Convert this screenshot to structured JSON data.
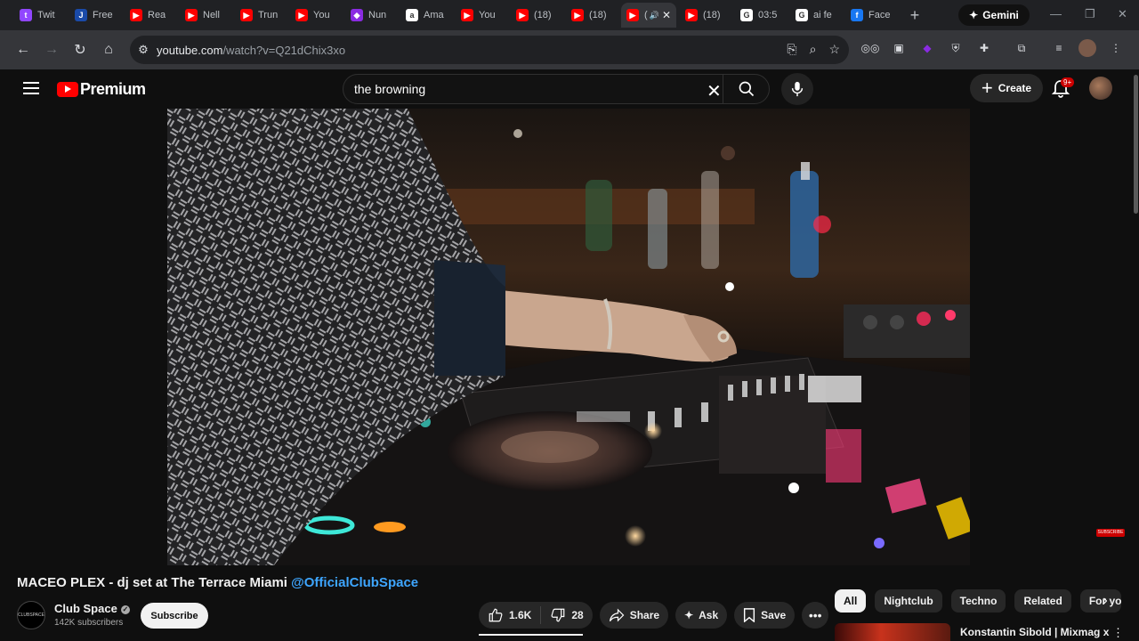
{
  "browser": {
    "tabs": [
      {
        "title": "Twit",
        "icon": "twitch-icon",
        "color": "#9146ff",
        "glyph": "t"
      },
      {
        "title": "Free",
        "icon": "j-icon",
        "color": "#1a4aa8",
        "glyph": "J"
      },
      {
        "title": "Rea",
        "icon": "youtube-icon",
        "color": "#ff0000",
        "glyph": "▶"
      },
      {
        "title": "Nell",
        "icon": "youtube-icon",
        "color": "#ff0000",
        "glyph": "▶"
      },
      {
        "title": "Trun",
        "icon": "youtube-icon",
        "color": "#ff0000",
        "glyph": "▶"
      },
      {
        "title": "You",
        "icon": "youtube-icon",
        "color": "#ff0000",
        "glyph": "▶"
      },
      {
        "title": "Nun",
        "icon": "nun-icon",
        "color": "#8a2be2",
        "glyph": "◆"
      },
      {
        "title": "Ama",
        "icon": "amazon-icon",
        "color": "#ffffff",
        "glyph": "a"
      },
      {
        "title": "You",
        "icon": "youtube-icon",
        "color": "#ff0000",
        "glyph": "▶"
      },
      {
        "title": "(18)",
        "icon": "youtube-icon",
        "color": "#ff0000",
        "glyph": "▶"
      },
      {
        "title": "(18)",
        "icon": "youtube-icon",
        "color": "#ff0000",
        "glyph": "▶"
      },
      {
        "title": "(",
        "icon": "youtube-icon",
        "color": "#ff0000",
        "glyph": "▶",
        "active": true
      },
      {
        "title": "(18)",
        "icon": "youtube-icon",
        "color": "#ff0000",
        "glyph": "▶"
      },
      {
        "title": "03:5",
        "icon": "google-icon",
        "color": "#ffffff",
        "glyph": "G"
      },
      {
        "title": "ai fe",
        "icon": "google-icon",
        "color": "#ffffff",
        "glyph": "G"
      },
      {
        "title": "Face",
        "icon": "facebook-icon",
        "color": "#1877f2",
        "glyph": "f"
      }
    ],
    "gemini_label": "Gemini",
    "url_host": "youtube.com",
    "url_path": "/watch?v=Q21dChix3xo"
  },
  "masthead": {
    "logo_text": "Premium",
    "search_value": "the browning",
    "create_label": "Create",
    "notification_badge": "9+"
  },
  "video": {
    "title": "MACEO PLEX - dj set at The Terrace Miami",
    "title_handle": "@OfficialClubSpace",
    "channel_name": "Club Space",
    "channel_avatar_text": "CLUBSPACE",
    "subscribers": "142K subscribers",
    "subscribe_label": "Subscribe",
    "overlay_subscribe": "SUBSCRIBE",
    "likes": "1.6K",
    "dislikes": "28",
    "share_label": "Share",
    "ask_label": "Ask",
    "save_label": "Save"
  },
  "chips": [
    "All",
    "Nightclub",
    "Techno",
    "Related",
    "For yo"
  ],
  "recommendation": {
    "title": "Konstantin Sibold | Mixmag x"
  }
}
